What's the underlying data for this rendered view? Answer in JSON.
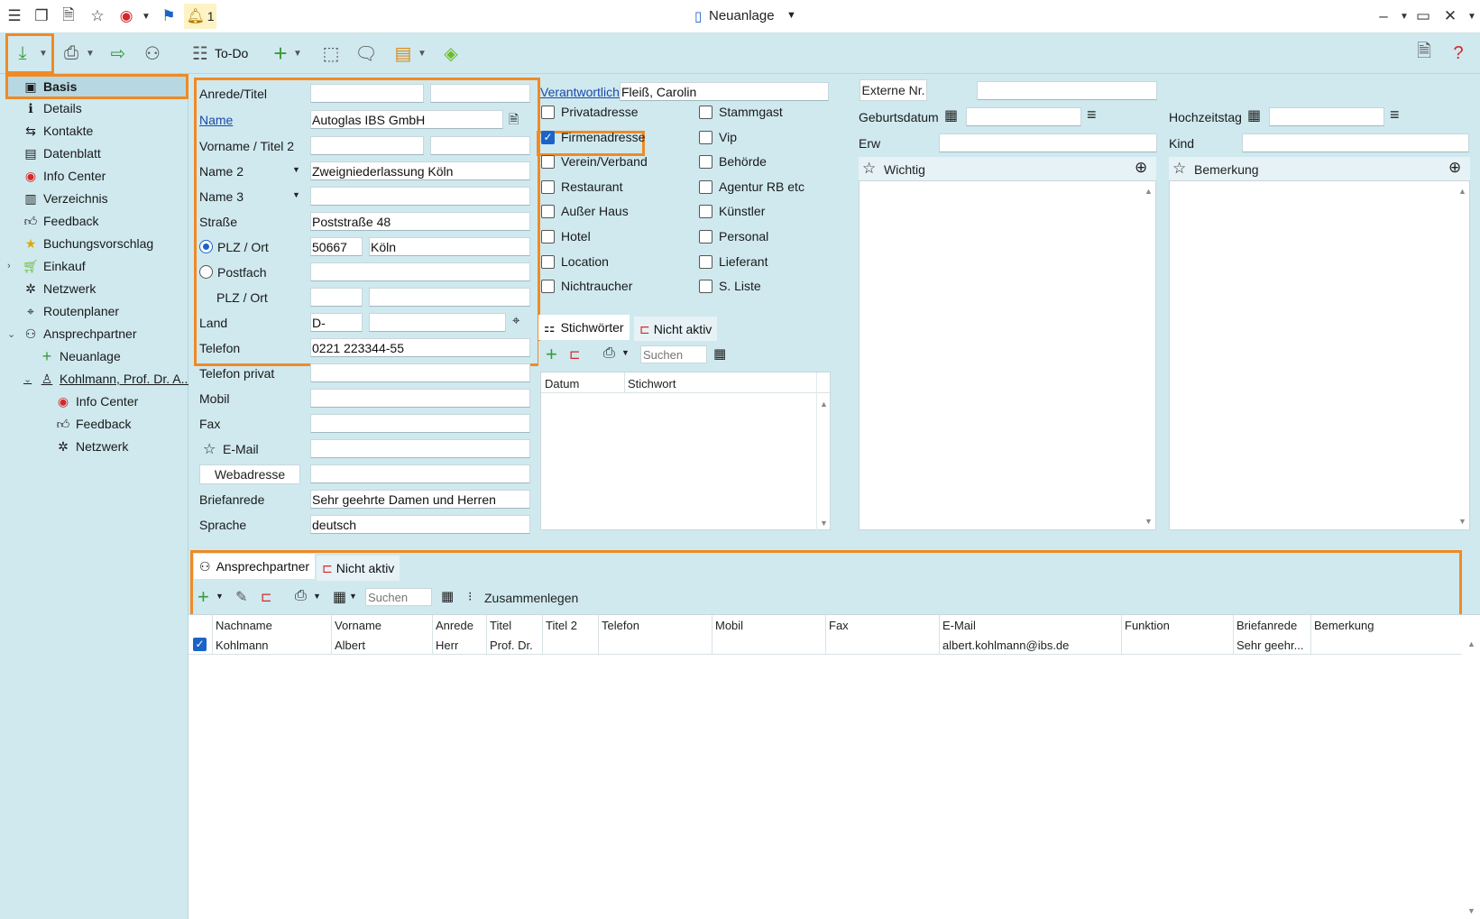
{
  "titlebar": {
    "title": "Neuanlage",
    "notification_count": "1"
  },
  "toolbar": {
    "todo_label": "To-Do"
  },
  "sidebar": {
    "items": [
      "Basis",
      "Details",
      "Kontakte",
      "Datenblatt",
      "Info Center",
      "Verzeichnis",
      "Feedback",
      "Buchungsvorschlag",
      "Einkauf",
      "Netzwerk",
      "Routenplaner",
      "Ansprechpartner",
      "Neuanlage",
      "Kohlmann, Prof. Dr. A...",
      "Info Center",
      "Feedback",
      "Netzwerk"
    ]
  },
  "form": {
    "anrede_label": "Anrede/Titel",
    "name_label": "Name",
    "name_value": "Autoglas IBS GmbH",
    "vorname_label": "Vorname / Titel 2",
    "name2_label": "Name 2",
    "name2_value": "Zweigniederlassung Köln",
    "name3_label": "Name 3",
    "strasse_label": "Straße",
    "strasse_value": "Poststraße 48",
    "plzort_label": "PLZ / Ort",
    "plz_value": "50667",
    "ort_value": "Köln",
    "postfach_label": "Postfach",
    "plzort2_label": "PLZ / Ort",
    "land_label": "Land",
    "land_value": "D-",
    "telefon_label": "Telefon",
    "telefon_value": "0221 223344-55",
    "telefon_privat_label": "Telefon privat",
    "mobil_label": "Mobil",
    "fax_label": "Fax",
    "email_label": "E-Mail",
    "webadresse_label": "Webadresse",
    "briefanrede_label": "Briefanrede",
    "briefanrede_value": "Sehr geehrte Damen und Herren",
    "sprache_label": "Sprache",
    "sprache_value": "deutsch"
  },
  "middle": {
    "verantwortlich_label": "Verantwortlich",
    "verantwortlich_value": "Fleiß, Carolin",
    "checkboxes_left": [
      {
        "label": "Privatadresse",
        "checked": false
      },
      {
        "label": "Firmenadresse",
        "checked": true
      },
      {
        "label": "Verein/Verband",
        "checked": false
      },
      {
        "label": "Restaurant",
        "checked": false
      },
      {
        "label": "Außer Haus",
        "checked": false
      },
      {
        "label": "Hotel",
        "checked": false
      },
      {
        "label": "Location",
        "checked": false
      },
      {
        "label": "Nichtraucher",
        "checked": false
      }
    ],
    "checkboxes_right": [
      {
        "label": "Stammgast",
        "checked": false
      },
      {
        "label": "Vip",
        "checked": false
      },
      {
        "label": "Behörde",
        "checked": false
      },
      {
        "label": "Agentur RB etc",
        "checked": false
      },
      {
        "label": "Künstler",
        "checked": false
      },
      {
        "label": "Personal",
        "checked": false
      },
      {
        "label": "Lieferant",
        "checked": false
      },
      {
        "label": "S. Liste",
        "checked": false
      }
    ],
    "tab_stichwoerter": "Stichwörter",
    "tab_nicht_aktiv": "Nicht aktiv",
    "search_placeholder": "Suchen",
    "col_datum": "Datum",
    "col_stichwort": "Stichwort"
  },
  "right": {
    "externe_nr_label": "Externe Nr.",
    "geburtsdatum_label": "Geburtsdatum",
    "hochzeitstag_label": "Hochzeitstag",
    "erw_label": "Erw",
    "kind_label": "Kind",
    "wichtig_label": "Wichtig",
    "bemerkung_label": "Bemerkung"
  },
  "bottom": {
    "tab_ansprechpartner": "Ansprechpartner",
    "tab_nicht_aktiv": "Nicht aktiv",
    "search_placeholder": "Suchen",
    "zusammenlegen_label": "Zusammenlegen",
    "columns": [
      "Nachname",
      "Vorname",
      "Anrede",
      "Titel",
      "Titel 2",
      "Telefon",
      "Mobil",
      "Fax",
      "E-Mail",
      "Funktion",
      "Briefanrede",
      "Bemerkung"
    ],
    "rows": [
      {
        "cells": [
          "Kohlmann",
          "Albert",
          "Herr",
          "Prof. Dr.",
          "",
          "",
          "",
          "",
          "albert.kohlmann@ibs.de",
          "",
          "Sehr geehr...",
          ""
        ]
      }
    ]
  }
}
